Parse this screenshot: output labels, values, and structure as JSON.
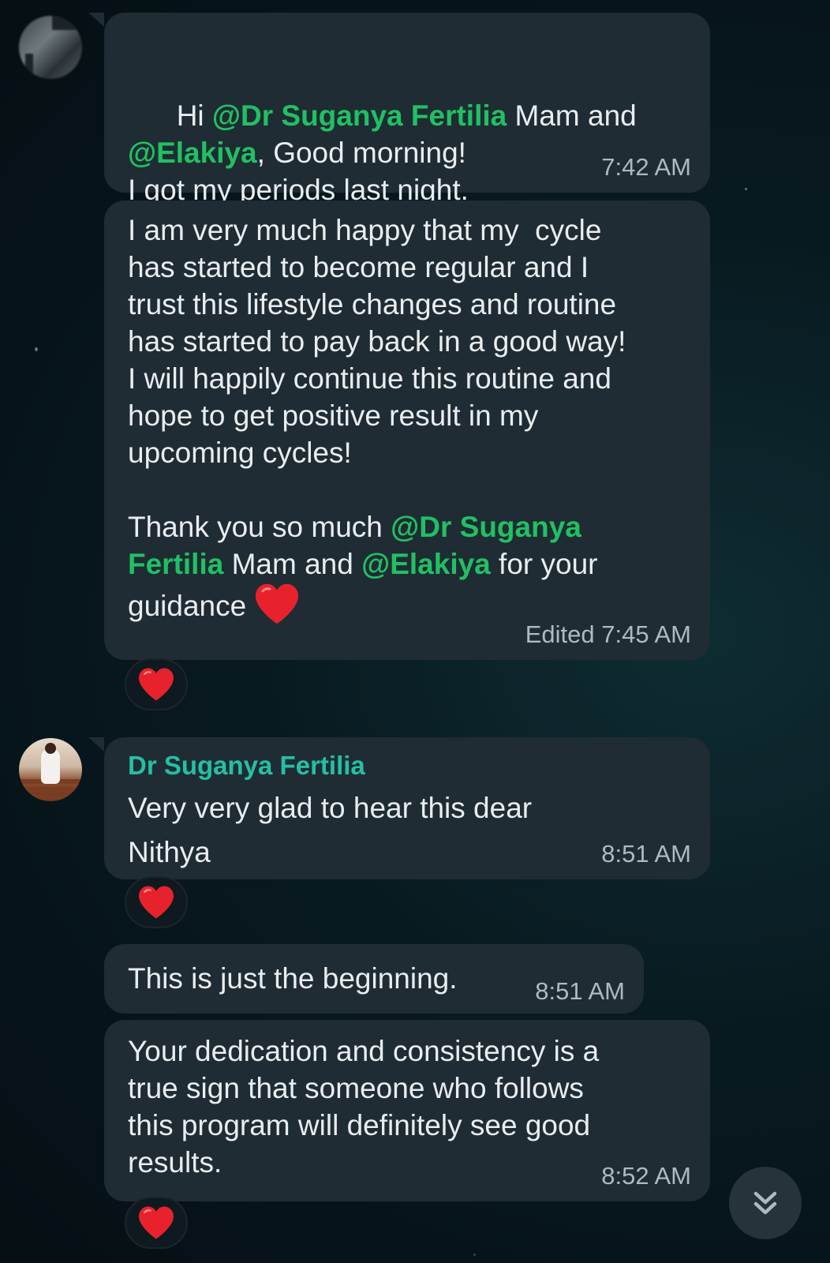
{
  "messages": [
    {
      "segments": [
        {
          "text": "Hi ",
          "type": "plain"
        },
        {
          "text": "@Dr Suganya Fertilia",
          "type": "mention"
        },
        {
          "text": " Mam and\n",
          "type": "plain"
        },
        {
          "text": "@Elakiya",
          "type": "mention"
        },
        {
          "text": ", Good morning!\nI got my periods last night.",
          "type": "plain"
        }
      ],
      "time": "7:42 AM"
    },
    {
      "segments": [
        {
          "text": "I am very much happy that my  cycle\nhas started to become regular and I\ntrust this lifestyle changes and routine\nhas started to pay back in a good way!\nI will happily continue this routine and\nhope to get positive result in my\nupcoming cycles!\n\nThank you so much ",
          "type": "plain"
        },
        {
          "text": "@Dr Suganya\nFertilia",
          "type": "mention"
        },
        {
          "text": " Mam and ",
          "type": "plain"
        },
        {
          "text": "@Elakiya",
          "type": "mention"
        },
        {
          "text": " for your\nguidance ",
          "type": "plain"
        }
      ],
      "time": "Edited 7:45 AM",
      "reaction": "heart"
    },
    {
      "sender": "Dr Suganya Fertilia",
      "text": "Very very glad to hear this dear\nNithya",
      "time": "8:51 AM",
      "reaction": "heart"
    },
    {
      "text": "This is just the beginning.",
      "time": "8:51 AM"
    },
    {
      "text": "Your dedication and consistency is a\ntrue sign that someone who follows\nthis program will definitely see good\nresults.",
      "time": "8:52 AM",
      "reaction": "heart"
    }
  ],
  "scroll_button": {
    "icon": "double-chevron-down-icon"
  },
  "colors": {
    "bubble": "#1f2c33",
    "mention": "#21c063",
    "sender": "#25bfa6",
    "timestamp": "#aebac1",
    "heart": "#e8222d"
  }
}
